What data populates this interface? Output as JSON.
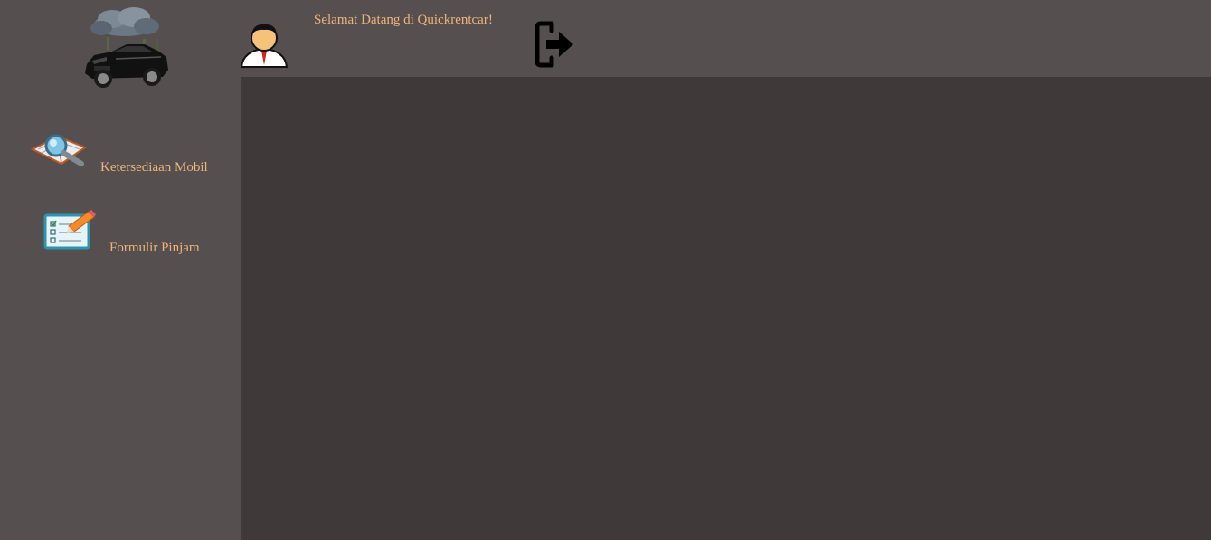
{
  "header": {
    "welcome_text": "Selamat Datang di Quickrentcar!",
    "user_icon": "user-avatar-icon",
    "logout_icon": "logout-icon"
  },
  "sidebar": {
    "logo_icon": "car-logo-icon",
    "items": [
      {
        "label": "Ketersediaan Mobil",
        "icon": "magnifier-book-icon"
      },
      {
        "label": "Formulir Pinjam",
        "icon": "form-pencil-icon"
      }
    ]
  },
  "colors": {
    "sidebar_bg": "#554f4f",
    "main_bg": "#3f3a39",
    "link_text": "#f0b478"
  }
}
